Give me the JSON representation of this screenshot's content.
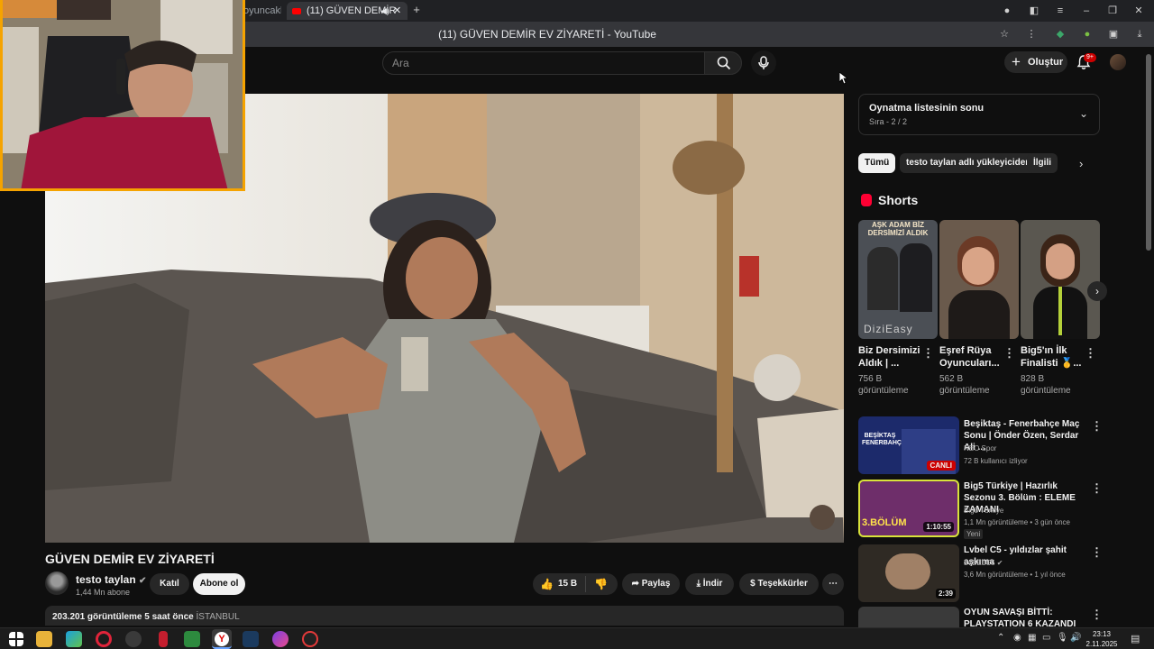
{
  "browser": {
    "tabs": [
      {
        "label": "oyuncakl",
        "active": false
      },
      {
        "label": "(11) GÜVEN DEMİR",
        "active": true
      }
    ],
    "window_title": "(11) GÜVEN DEMİR EV ZİYARETİ - YouTube"
  },
  "masthead": {
    "search_placeholder": "Ara",
    "create_label": "Oluştur",
    "notifications_badge": "9+"
  },
  "video": {
    "title": "GÜVEN DEMİR EV ZİYARETİ",
    "channel": "testo taylan",
    "subscribers": "1,44 Mn abone",
    "join_label": "Katıl",
    "subscribe_label": "Abone ol",
    "likes": "15 B",
    "share_label": "Paylaş",
    "download_label": "İndir",
    "thanks_label": "Teşekkürler",
    "views": "203.201 görüntüleme",
    "age": "5 saat önce",
    "location": "İSTANBUL"
  },
  "playlist": {
    "title": "Oynatma listesinin sonu",
    "position": "Sıra - 2 / 2"
  },
  "chips": [
    "Tümü",
    "testo taylan adlı yükleyiciden",
    "İlgili"
  ],
  "shorts": {
    "heading": "Shorts",
    "items": [
      {
        "title": "Biz Dersimizi Aldık | ...",
        "views": "756 B görüntüleme",
        "thumb_text": "AŞK ADAM BİZ DERSİMİZİ ALDIK",
        "watermark": "DiziEasy"
      },
      {
        "title": "Eşref Rüya Oyuncuları...",
        "views": "562 B görüntüleme"
      },
      {
        "title": "Big5'ın İlk Finalisti 🥇...",
        "views": "828 B görüntüleme"
      }
    ]
  },
  "recommendations": [
    {
      "title": "Beşiktaş - Fenerbahçe Maç Sonu | Önder Özen, Serdar Ali ...",
      "channel": "NEO Spor",
      "meta": "72 B kullanıcı izliyor",
      "badge": "CANLI",
      "thumb_text": "BEŞİKTAŞ FENERBAHÇE"
    },
    {
      "title": "Big5 Türkiye | Hazırlık Sezonu 3. Bölüm : ELEME ZAMANI",
      "channel": "Big5 Türkiye",
      "meta": "1,1 Mn görüntüleme • 3 gün önce",
      "badge": "1:10:55",
      "extra": "Yeni",
      "thumb_text": "3.BÖLÜM"
    },
    {
      "title": "Lvbel C5 - yıldızlar şahit aşkıma",
      "channel": "LVBELC5",
      "meta": "3,6 Mn görüntüleme • 1 yıl önce",
      "badge": "2:39"
    },
    {
      "title": "OYUN SAVAŞI BİTTİ: PLAYSTATION 6 KAZANDI",
      "channel": "",
      "meta": ""
    }
  ],
  "taskbar": {
    "time": "23:13",
    "date": "2.11.2025"
  },
  "colors": {
    "background": "#0f0f0f",
    "accent_red": "#ff0000",
    "webcam_border": "#f5a300",
    "chip_active": "#f1f1f1"
  }
}
